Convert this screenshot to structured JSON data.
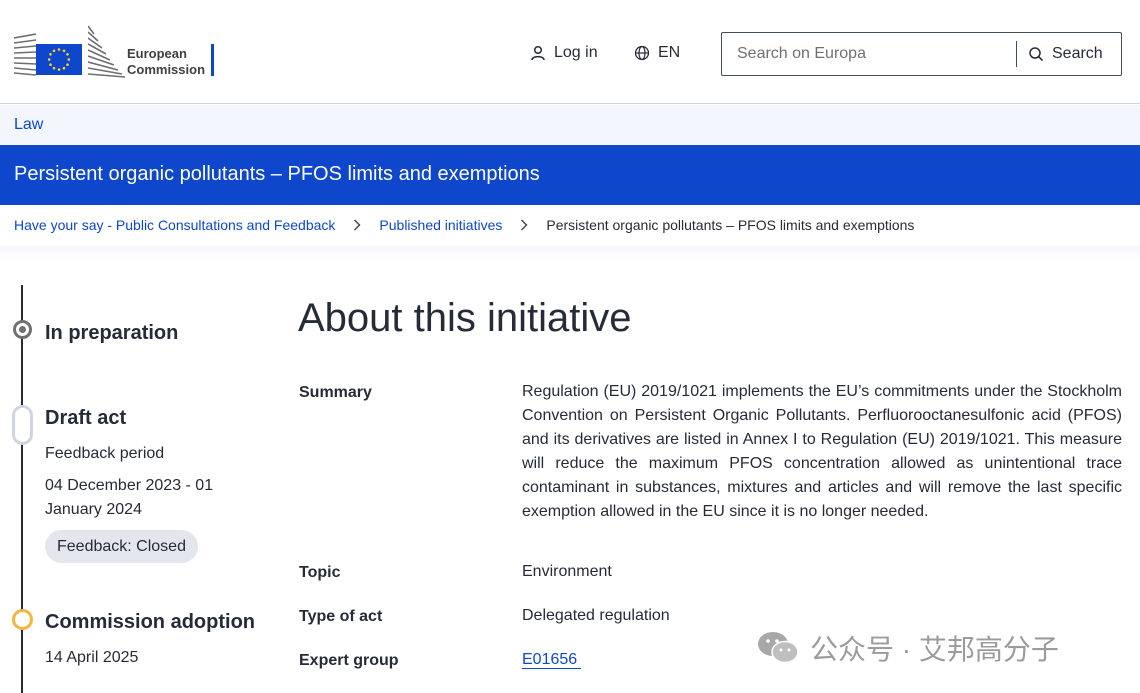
{
  "header": {
    "logo_line1": "European",
    "logo_line2": "Commission",
    "login_label": "Log in",
    "language_label": "EN",
    "search_placeholder": "Search on Europa",
    "search_button_label": "Search"
  },
  "lawbar": {
    "label": "Law"
  },
  "page_title": "Persistent organic pollutants – PFOS limits and exemptions",
  "breadcrumb": [
    {
      "label": "Have your say - Public Consultations and Feedback"
    },
    {
      "label": "Published initiatives"
    },
    {
      "label": "Persistent organic pollutants – PFOS limits and exemptions"
    }
  ],
  "timeline": {
    "stage1": {
      "title": "In preparation"
    },
    "stage2": {
      "title": "Draft act",
      "period_label": "Feedback period",
      "period_dates_line1": "04 December 2023 - 01",
      "period_dates_line2": "January 2024",
      "feedback_status": "Feedback: Closed"
    },
    "stage3": {
      "title": "Commission adoption",
      "date": "14 April 2025"
    }
  },
  "about": {
    "heading": "About this initiative",
    "summary_label": "Summary",
    "summary_text": "Regulation (EU) 2019/1021 implements the EU’s commitments under the Stockholm Convention on Persistent Organic Pollutants. Perfluorooctanesulfonic acid (PFOS) and its derivatives are listed in Annex I to Regulation (EU) 2019/1021. This measure will reduce the maximum PFOS concentration allowed as unintentional trace contaminant in substances, mixtures and articles and will remove the last specific exemption allowed in the EU since it is no longer needed.",
    "topic_label": "Topic",
    "topic_value": "Environment",
    "type_label": "Type of act",
    "type_value": "Delegated regulation",
    "expert_label": "Expert group",
    "expert_value": "E01656"
  },
  "watermark": {
    "text": "公众号 · 艾邦高分子"
  },
  "colors": {
    "brand_blue": "#0e47cb",
    "text_dark": "#262b38",
    "commission_yellow": "#f4b63f",
    "lawbar_bg": "#f3f6fc"
  }
}
